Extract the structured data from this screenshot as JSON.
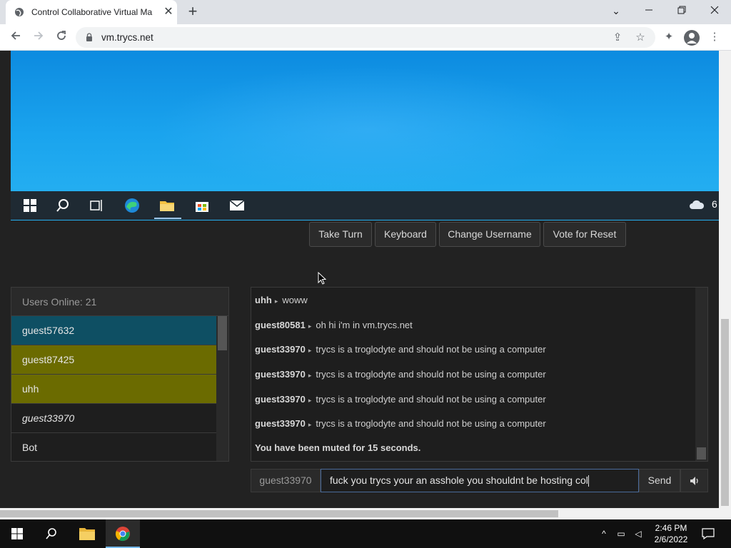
{
  "browser": {
    "tab_title": "Control Collaborative Virtual Ma",
    "url": "vm.trycs.net",
    "new_tab_symbol": "+",
    "tab_close_symbol": "✕"
  },
  "controls": {
    "take_turn": "Take Turn",
    "keyboard": "Keyboard",
    "change_username": "Change Username",
    "vote_reset": "Vote for Reset"
  },
  "vm": {
    "weather_text": "6"
  },
  "users": {
    "header": "Users Online: 21",
    "list": [
      {
        "name": "guest57632",
        "bg": "#0e4f63"
      },
      {
        "name": "guest87425",
        "bg": "#6b6b00"
      },
      {
        "name": "uhh",
        "bg": "#6b6b00"
      },
      {
        "name": "guest33970",
        "bg": "#1e1e1e"
      },
      {
        "name": "Bot",
        "bg": "#1e1e1e"
      }
    ]
  },
  "chat": {
    "messages": [
      {
        "user": "uhh",
        "text": "woww"
      },
      {
        "user": "guest80581",
        "text": "oh hi i'm in vm.trycs.net"
      },
      {
        "user": "guest33970",
        "text": "trycs is a troglodyte and should not be using a computer"
      },
      {
        "user": "guest33970",
        "text": "trycs is a troglodyte and should not be using a computer"
      },
      {
        "user": "guest33970",
        "text": "trycs is a troglodyte and should not be using a computer"
      },
      {
        "user": "guest33970",
        "text": "trycs is a troglodyte and should not be using a computer"
      }
    ],
    "system_message": "You have been muted for 15 seconds.",
    "arrow": "▸",
    "username": "guest33970",
    "input_value": "fuck you trycs your an asshole you shouldnt be hosting col",
    "send_label": "Send"
  },
  "taskbar": {
    "time": "2:46 PM",
    "date": "2/6/2022"
  },
  "colors": {
    "vm_blue": "#1aa4ee",
    "highlight_teal": "#0e4f63",
    "highlight_olive": "#6b6b00"
  }
}
